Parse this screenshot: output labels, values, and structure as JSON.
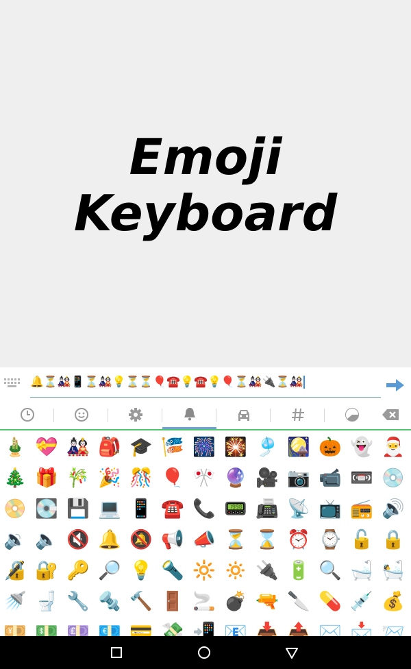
{
  "app": {
    "title_line1": "Emoji",
    "title_line2": "Keyboard"
  },
  "input": {
    "typed_text": "🔔⏳🎎📱⏳🎎💡⏳⏳🎈☎️💡☎️💡🎈⏳🎎🔌⏳🎎",
    "enter_icon": "arrow-right-icon"
  },
  "tabs": [
    {
      "name": "recent",
      "icon": "clock-icon",
      "active": false
    },
    {
      "name": "people",
      "icon": "smiley-icon",
      "active": false
    },
    {
      "name": "nature",
      "icon": "gear-icon",
      "active": false
    },
    {
      "name": "objects",
      "icon": "bell-icon",
      "active": true
    },
    {
      "name": "places",
      "icon": "car-icon",
      "active": false
    },
    {
      "name": "symbols",
      "icon": "hash-icon",
      "active": false
    },
    {
      "name": "other",
      "icon": "pie-icon",
      "active": false
    },
    {
      "name": "delete",
      "icon": "backspace-icon",
      "active": false
    }
  ],
  "emoji_rows": [
    [
      "🎍",
      "💝",
      "🎎",
      "🎒",
      "🎓",
      "🎏",
      "🎆",
      "🎇",
      "🎐",
      "🎑",
      "🎃",
      "👻",
      "🎅"
    ],
    [
      "🎄",
      "🎁",
      "🎋",
      "🎉",
      "🎊",
      "🎈",
      "🎌",
      "🔮",
      "🎥",
      "📷",
      "📹",
      "📼",
      "💿"
    ],
    [
      "📀",
      "💽",
      "💾",
      "💻",
      "📱",
      "☎️",
      "📞",
      "📟",
      "📠",
      "📡",
      "📺",
      "📻",
      "🔊"
    ],
    [
      "🔉",
      "🔈",
      "🔇",
      "🔔",
      "🔕",
      "📢",
      "📣",
      "⏳",
      "⌛",
      "⏰",
      "⌚",
      "🔓",
      "🔒"
    ],
    [
      "🔏",
      "🔐",
      "🔑",
      "🔎",
      "💡",
      "🔦",
      "🔆",
      "🔅",
      "🔌",
      "🔋",
      "🔍",
      "🛁",
      "🛀"
    ],
    [
      "🚿",
      "🚽",
      "🔧",
      "🔩",
      "🔨",
      "🚪",
      "🚬",
      "💣",
      "🔫",
      "🔪",
      "💊",
      "💉",
      "💰"
    ],
    [
      "💴",
      "💵",
      "💷",
      "💶",
      "💳",
      "💸",
      "📲",
      "📧",
      "📥",
      "📤",
      "✉️",
      "📩",
      "📨"
    ]
  ],
  "colors": {
    "accent_green": "#4cc86a",
    "tab_active": "#6fa0d8",
    "enter_blue": "#5b9bd5",
    "icon_gray": "#9a9a9a"
  },
  "nav": {
    "recents_icon": "square-icon",
    "home_icon": "circle-icon",
    "back_icon": "triangle-icon"
  }
}
